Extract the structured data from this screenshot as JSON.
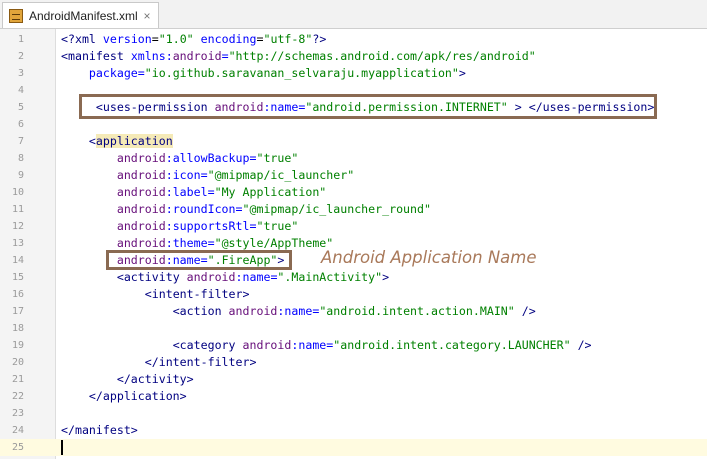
{
  "tab": {
    "title": "AndroidManifest.xml",
    "close_label": "×",
    "icon": "xml-file-icon"
  },
  "line_numbers": [
    "1",
    "2",
    "3",
    "4",
    "5",
    "6",
    "7",
    "8",
    "9",
    "10",
    "11",
    "12",
    "13",
    "14",
    "15",
    "16",
    "17",
    "18",
    "19",
    "20",
    "21",
    "22",
    "23",
    "24",
    "25"
  ],
  "code": {
    "l1": {
      "open": "<?",
      "tag": "xml",
      "a1": "version",
      "v1": "\"1.0\"",
      "a2": "encoding",
      "v2": "\"utf-8\"",
      "close": "?>"
    },
    "l2": {
      "open": "<",
      "tag": "manifest",
      "a1": "xmlns:",
      "ns": "android",
      "eq": "=",
      "v1": "\"http://schemas.android.com/apk/res/android\""
    },
    "l3": {
      "attr": "package",
      "eq": "=",
      "val": "\"io.github.saravanan_selvaraju.myapplication\"",
      "close": ">"
    },
    "l5": {
      "open": "<",
      "tag": "uses-permission",
      "ns": "android",
      "attr": ":name",
      "eq": "=",
      "val": "\"android.permission.INTERNET\"",
      "mid": " > ",
      "end": "</uses-permission>"
    },
    "l7": {
      "open": "<",
      "tag": "application"
    },
    "l8": {
      "ns": "android",
      "attr": ":allowBackup",
      "eq": "=",
      "val": "\"true\""
    },
    "l9": {
      "ns": "android",
      "attr": ":icon",
      "eq": "=",
      "val": "\"@mipmap/ic_launcher\""
    },
    "l10": {
      "ns": "android",
      "attr": ":label",
      "eq": "=",
      "val": "\"My Application\""
    },
    "l11": {
      "ns": "android",
      "attr": ":roundIcon",
      "eq": "=",
      "val": "\"@mipmap/ic_launcher_round\""
    },
    "l12": {
      "ns": "android",
      "attr": ":supportsRtl",
      "eq": "=",
      "val": "\"true\""
    },
    "l13": {
      "ns": "android",
      "attr": ":theme",
      "eq": "=",
      "val": "\"@style/AppTheme\""
    },
    "l14": {
      "ns": "android",
      "attr": ":name",
      "eq": "=",
      "val": "\".FireApp\"",
      "close": ">"
    },
    "l15": {
      "open": "<",
      "tag": "activity",
      "ns": "android",
      "attr": ":name",
      "eq": "=",
      "val": "\".MainActivity\"",
      "close": ">"
    },
    "l16": {
      "open": "<",
      "tag": "intent-filter",
      "close": ">"
    },
    "l17": {
      "open": "<",
      "tag": "action",
      "ns": "android",
      "attr": ":name",
      "eq": "=",
      "val": "\"android.intent.action.MAIN\"",
      "close": " />"
    },
    "l19": {
      "open": "<",
      "tag": "category",
      "ns": "android",
      "attr": ":name",
      "eq": "=",
      "val": "\"android.intent.category.LAUNCHER\"",
      "close": " />"
    },
    "l20": {
      "text": "</intent-filter>"
    },
    "l21": {
      "text": "</activity>"
    },
    "l22": {
      "text": "</application>"
    },
    "l24": {
      "text": "</manifest>"
    }
  },
  "annotation": {
    "text": "Android Application Name"
  },
  "colors": {
    "tag": "#000080",
    "namespace": "#660e7a",
    "attribute": "#0000ff",
    "value": "#008000",
    "box": "#8a6a52",
    "annotation": "#a9795a"
  }
}
